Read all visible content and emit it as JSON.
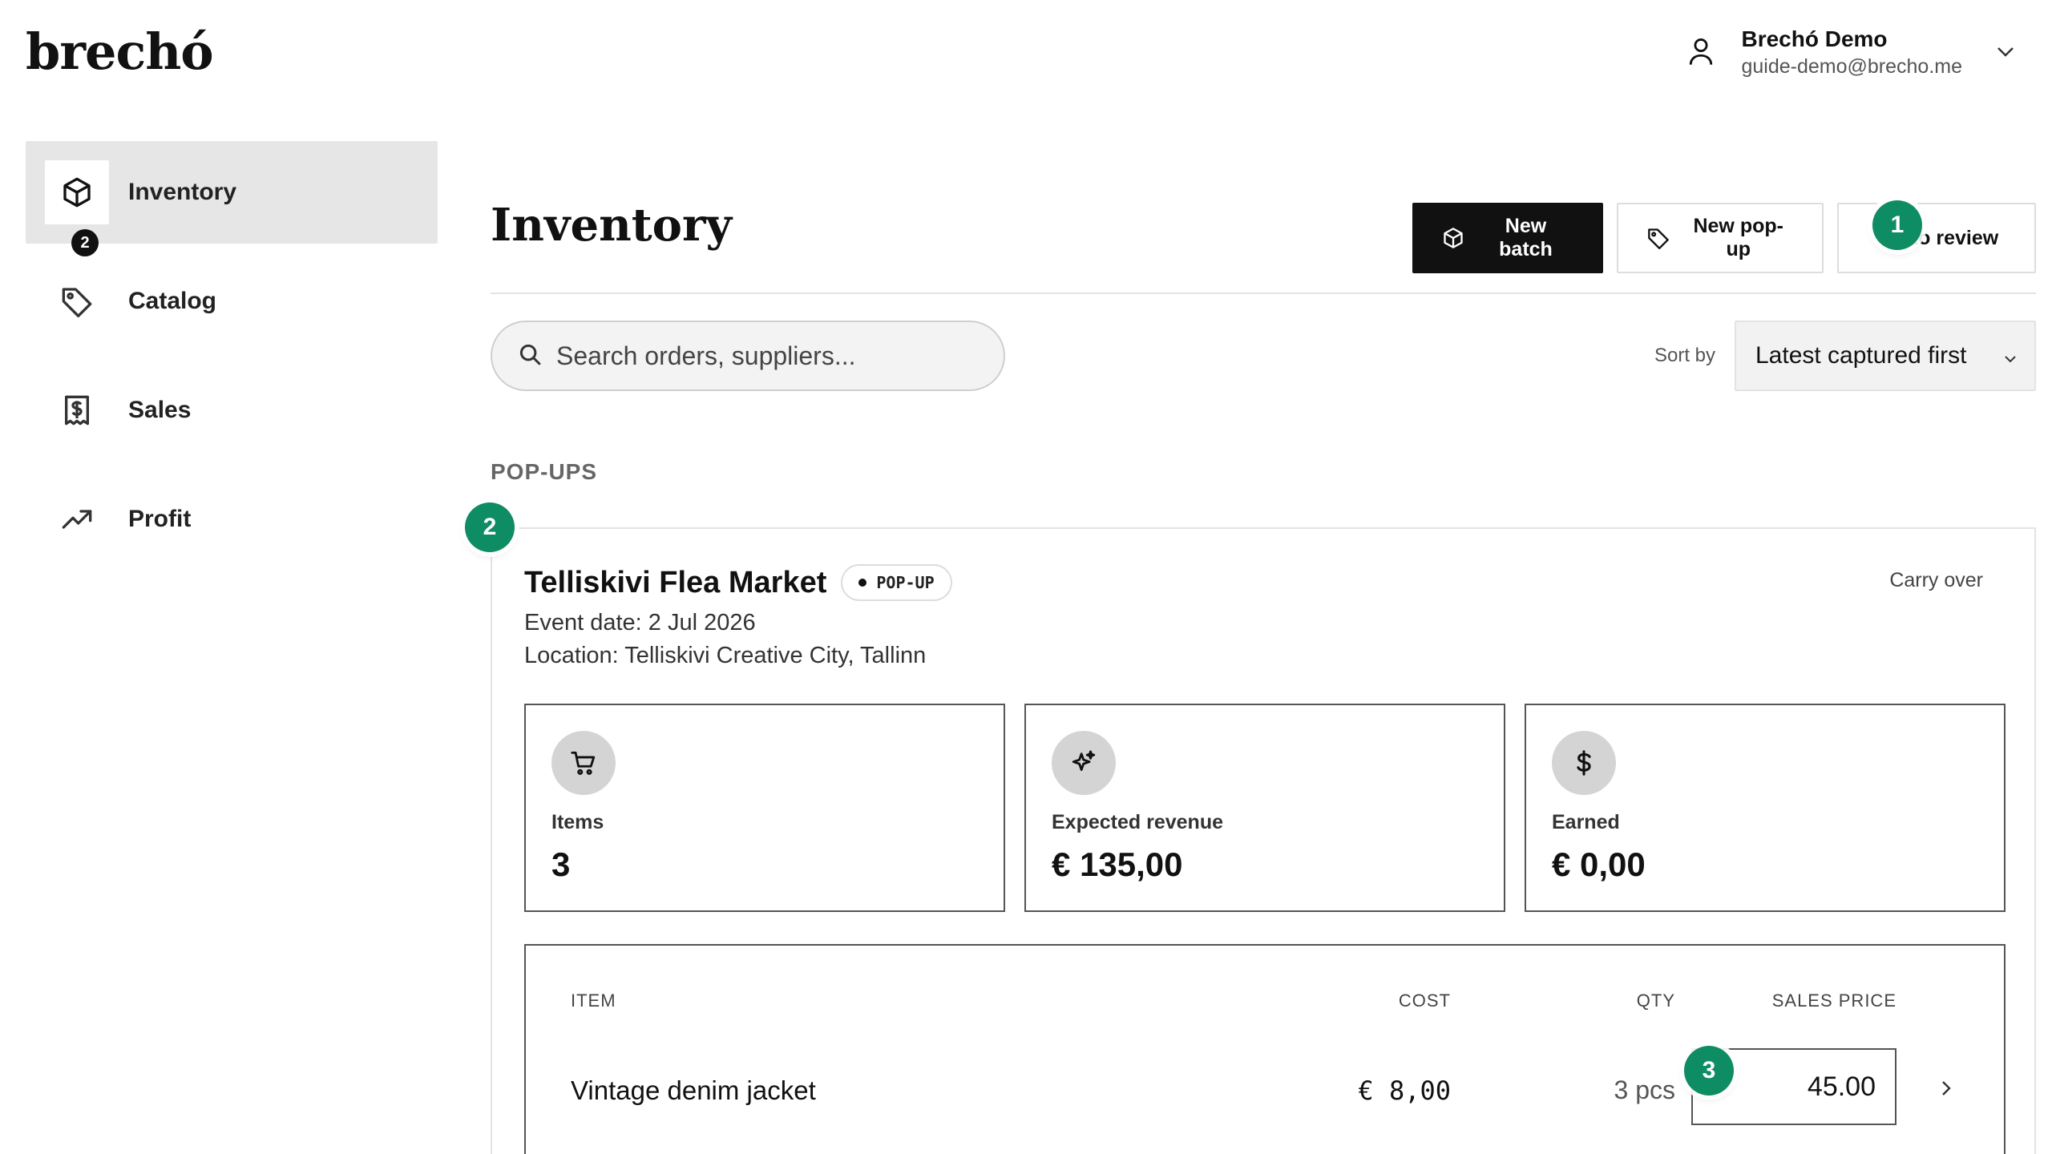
{
  "brand": {
    "logo": "brechó"
  },
  "user": {
    "name": "Brechó Demo",
    "email": "guide-demo@brecho.me"
  },
  "sidebar": {
    "items": [
      {
        "label": "Inventory",
        "icon": "box-icon",
        "active": true
      },
      {
        "label": "Catalog",
        "icon": "tag-icon"
      },
      {
        "label": "Sales",
        "icon": "receipt-icon",
        "badge": "2"
      },
      {
        "label": "Profit",
        "icon": "trending-up-icon"
      }
    ]
  },
  "main": {
    "title": "Inventory",
    "actions": {
      "new_batch": "New batch",
      "new_popup": "New pop-up",
      "to_review": "to review"
    },
    "search": {
      "placeholder": "Search orders, suppliers..."
    },
    "sort": {
      "label": "Sort by",
      "value": "Latest captured first"
    },
    "section_label": "POP-UPS"
  },
  "popup": {
    "title": "Telliskivi Flea Market",
    "tag": "POP-UP",
    "event_date": "Event date: 2 Jul 2026",
    "location": "Location: Telliskivi Creative City, Tallinn",
    "carry_over": "Carry over",
    "stats": [
      {
        "label": "Items",
        "value": "3",
        "icon": "cart-icon"
      },
      {
        "label": "Expected revenue",
        "value": "€ 135,00",
        "icon": "sparkles-icon"
      },
      {
        "label": "Earned",
        "value": "€ 0,00",
        "icon": "dollar-icon"
      }
    ],
    "table": {
      "headers": {
        "item": "ITEM",
        "cost": "COST",
        "qty": "QTY",
        "sales_price": "SALES PRICE"
      },
      "rows": [
        {
          "item": "Vintage denim jacket",
          "cost": "€ 8,00",
          "qty": "3 pcs",
          "sales_price": "45.00"
        }
      ]
    }
  },
  "steps": [
    "1",
    "2",
    "3"
  ],
  "colors": {
    "step_marker": "#0e8c63",
    "primary_button": "#111111",
    "active_nav": "#e6e6e6"
  }
}
